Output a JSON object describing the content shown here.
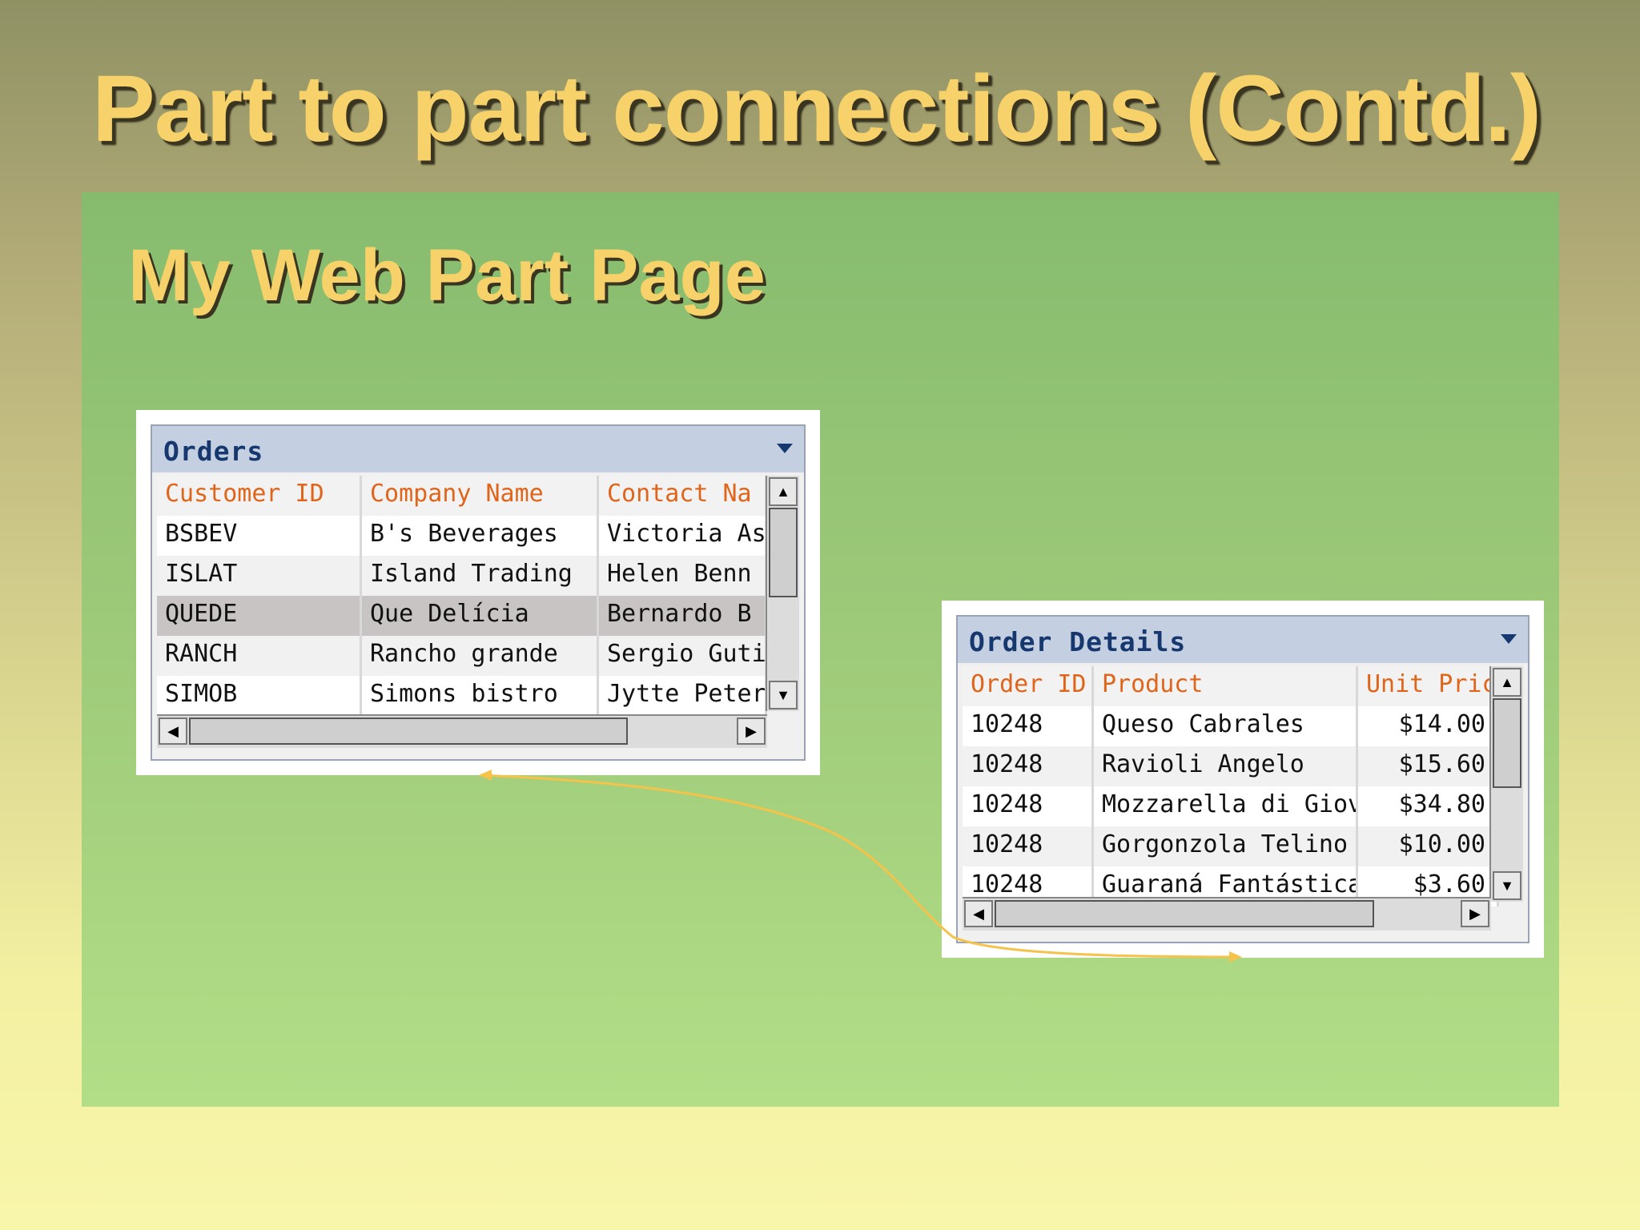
{
  "slide": {
    "title": "Part to part connections (Contd.)"
  },
  "page": {
    "title": "My Web Part Page"
  },
  "orders": {
    "title": "Orders",
    "columns": [
      "Customer ID",
      "Company Name",
      "Contact Na"
    ],
    "rows": [
      [
        "BSBEV",
        "B's Beverages",
        "Victoria Ash"
      ],
      [
        "ISLAT",
        "Island Trading",
        "Helen Benn"
      ],
      [
        "QUEDE",
        "Que Delícia",
        "Bernardo B"
      ],
      [
        "RANCH",
        "Rancho grande",
        "Sergio Gutié"
      ],
      [
        "SIMOB",
        "Simons bistro",
        "Jytte Peters"
      ]
    ],
    "selected_row": 2
  },
  "order_details": {
    "title": "Order Details",
    "columns": [
      "Order ID",
      "Product",
      "Unit Price"
    ],
    "rows": [
      [
        "10248",
        "Queso Cabrales",
        "$14.00"
      ],
      [
        "10248",
        "Ravioli Angelo",
        "$15.60"
      ],
      [
        "10248",
        "Mozzarella di Giov",
        "$34.80"
      ],
      [
        "10248",
        "Gorgonzola Telino",
        "$10.00"
      ],
      [
        "10248",
        "Guaraná Fantástica",
        "$3.60"
      ]
    ]
  },
  "connection": {
    "color": "#f5c24a"
  },
  "icons": {
    "menu": "chevron-down-icon",
    "scroll_up": "scroll-up-arrow-icon",
    "scroll_down": "scroll-down-arrow-icon",
    "scroll_left": "scroll-left-arrow-icon",
    "scroll_right": "scroll-right-arrow-icon"
  }
}
